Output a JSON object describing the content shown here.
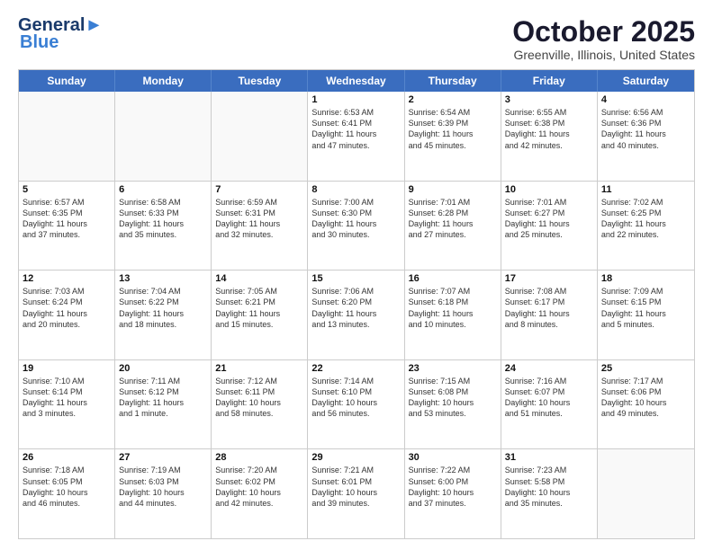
{
  "header": {
    "logo_line1": "General",
    "logo_line2": "Blue",
    "month": "October 2025",
    "location": "Greenville, Illinois, United States"
  },
  "weekdays": [
    "Sunday",
    "Monday",
    "Tuesday",
    "Wednesday",
    "Thursday",
    "Friday",
    "Saturday"
  ],
  "rows": [
    [
      {
        "day": "",
        "text": ""
      },
      {
        "day": "",
        "text": ""
      },
      {
        "day": "",
        "text": ""
      },
      {
        "day": "1",
        "text": "Sunrise: 6:53 AM\nSunset: 6:41 PM\nDaylight: 11 hours\nand 47 minutes."
      },
      {
        "day": "2",
        "text": "Sunrise: 6:54 AM\nSunset: 6:39 PM\nDaylight: 11 hours\nand 45 minutes."
      },
      {
        "day": "3",
        "text": "Sunrise: 6:55 AM\nSunset: 6:38 PM\nDaylight: 11 hours\nand 42 minutes."
      },
      {
        "day": "4",
        "text": "Sunrise: 6:56 AM\nSunset: 6:36 PM\nDaylight: 11 hours\nand 40 minutes."
      }
    ],
    [
      {
        "day": "5",
        "text": "Sunrise: 6:57 AM\nSunset: 6:35 PM\nDaylight: 11 hours\nand 37 minutes."
      },
      {
        "day": "6",
        "text": "Sunrise: 6:58 AM\nSunset: 6:33 PM\nDaylight: 11 hours\nand 35 minutes."
      },
      {
        "day": "7",
        "text": "Sunrise: 6:59 AM\nSunset: 6:31 PM\nDaylight: 11 hours\nand 32 minutes."
      },
      {
        "day": "8",
        "text": "Sunrise: 7:00 AM\nSunset: 6:30 PM\nDaylight: 11 hours\nand 30 minutes."
      },
      {
        "day": "9",
        "text": "Sunrise: 7:01 AM\nSunset: 6:28 PM\nDaylight: 11 hours\nand 27 minutes."
      },
      {
        "day": "10",
        "text": "Sunrise: 7:01 AM\nSunset: 6:27 PM\nDaylight: 11 hours\nand 25 minutes."
      },
      {
        "day": "11",
        "text": "Sunrise: 7:02 AM\nSunset: 6:25 PM\nDaylight: 11 hours\nand 22 minutes."
      }
    ],
    [
      {
        "day": "12",
        "text": "Sunrise: 7:03 AM\nSunset: 6:24 PM\nDaylight: 11 hours\nand 20 minutes."
      },
      {
        "day": "13",
        "text": "Sunrise: 7:04 AM\nSunset: 6:22 PM\nDaylight: 11 hours\nand 18 minutes."
      },
      {
        "day": "14",
        "text": "Sunrise: 7:05 AM\nSunset: 6:21 PM\nDaylight: 11 hours\nand 15 minutes."
      },
      {
        "day": "15",
        "text": "Sunrise: 7:06 AM\nSunset: 6:20 PM\nDaylight: 11 hours\nand 13 minutes."
      },
      {
        "day": "16",
        "text": "Sunrise: 7:07 AM\nSunset: 6:18 PM\nDaylight: 11 hours\nand 10 minutes."
      },
      {
        "day": "17",
        "text": "Sunrise: 7:08 AM\nSunset: 6:17 PM\nDaylight: 11 hours\nand 8 minutes."
      },
      {
        "day": "18",
        "text": "Sunrise: 7:09 AM\nSunset: 6:15 PM\nDaylight: 11 hours\nand 5 minutes."
      }
    ],
    [
      {
        "day": "19",
        "text": "Sunrise: 7:10 AM\nSunset: 6:14 PM\nDaylight: 11 hours\nand 3 minutes."
      },
      {
        "day": "20",
        "text": "Sunrise: 7:11 AM\nSunset: 6:12 PM\nDaylight: 11 hours\nand 1 minute."
      },
      {
        "day": "21",
        "text": "Sunrise: 7:12 AM\nSunset: 6:11 PM\nDaylight: 10 hours\nand 58 minutes."
      },
      {
        "day": "22",
        "text": "Sunrise: 7:14 AM\nSunset: 6:10 PM\nDaylight: 10 hours\nand 56 minutes."
      },
      {
        "day": "23",
        "text": "Sunrise: 7:15 AM\nSunset: 6:08 PM\nDaylight: 10 hours\nand 53 minutes."
      },
      {
        "day": "24",
        "text": "Sunrise: 7:16 AM\nSunset: 6:07 PM\nDaylight: 10 hours\nand 51 minutes."
      },
      {
        "day": "25",
        "text": "Sunrise: 7:17 AM\nSunset: 6:06 PM\nDaylight: 10 hours\nand 49 minutes."
      }
    ],
    [
      {
        "day": "26",
        "text": "Sunrise: 7:18 AM\nSunset: 6:05 PM\nDaylight: 10 hours\nand 46 minutes."
      },
      {
        "day": "27",
        "text": "Sunrise: 7:19 AM\nSunset: 6:03 PM\nDaylight: 10 hours\nand 44 minutes."
      },
      {
        "day": "28",
        "text": "Sunrise: 7:20 AM\nSunset: 6:02 PM\nDaylight: 10 hours\nand 42 minutes."
      },
      {
        "day": "29",
        "text": "Sunrise: 7:21 AM\nSunset: 6:01 PM\nDaylight: 10 hours\nand 39 minutes."
      },
      {
        "day": "30",
        "text": "Sunrise: 7:22 AM\nSunset: 6:00 PM\nDaylight: 10 hours\nand 37 minutes."
      },
      {
        "day": "31",
        "text": "Sunrise: 7:23 AM\nSunset: 5:58 PM\nDaylight: 10 hours\nand 35 minutes."
      },
      {
        "day": "",
        "text": ""
      }
    ]
  ]
}
